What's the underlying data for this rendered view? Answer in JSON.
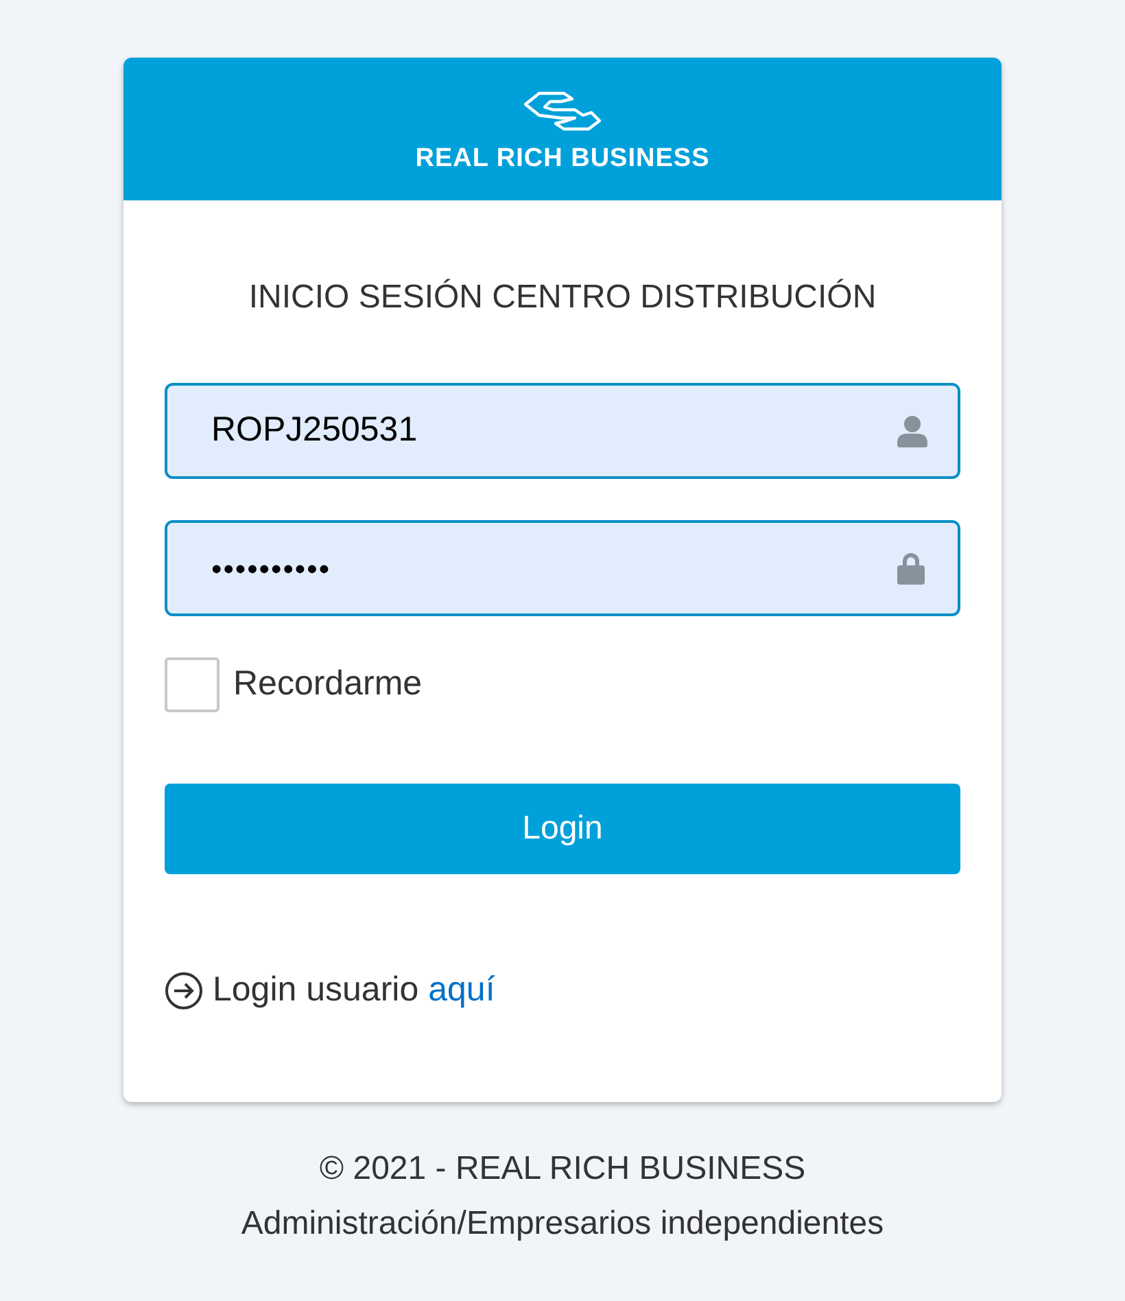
{
  "logo": {
    "text": "REAL RICH BUSINESS"
  },
  "title": "INICIO SESIÓN CENTRO DISTRIBUCIÓN",
  "username": {
    "value": "ROPJ250531"
  },
  "password": {
    "value": "••••••••••"
  },
  "remember": {
    "label": "Recordarme",
    "checked": false
  },
  "login_button": "Login",
  "user_login": {
    "text": "Login usuario",
    "link": "aquí"
  },
  "footer": [
    "© 2021 - REAL RICH BUSINESS",
    "Administración/Empresarios independientes"
  ]
}
